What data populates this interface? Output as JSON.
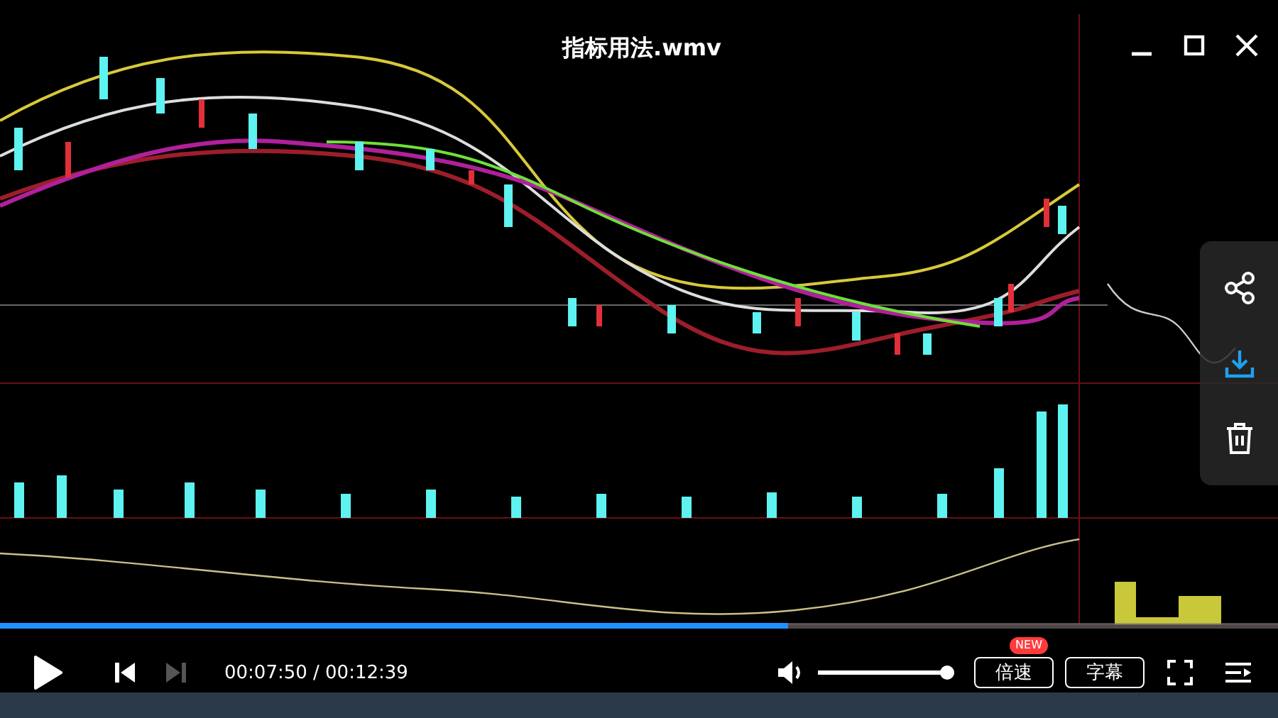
{
  "title": "指标用法.wmv",
  "playback": {
    "playing": false,
    "level": 0.617,
    "time": "00:07:50 / 00:12:39"
  },
  "volume": {
    "muted": false,
    "level": 1
  },
  "buttons": [
    {
      "label": "倍速",
      "badge": "NEW"
    },
    {
      "label": "字幕"
    }
  ]
}
